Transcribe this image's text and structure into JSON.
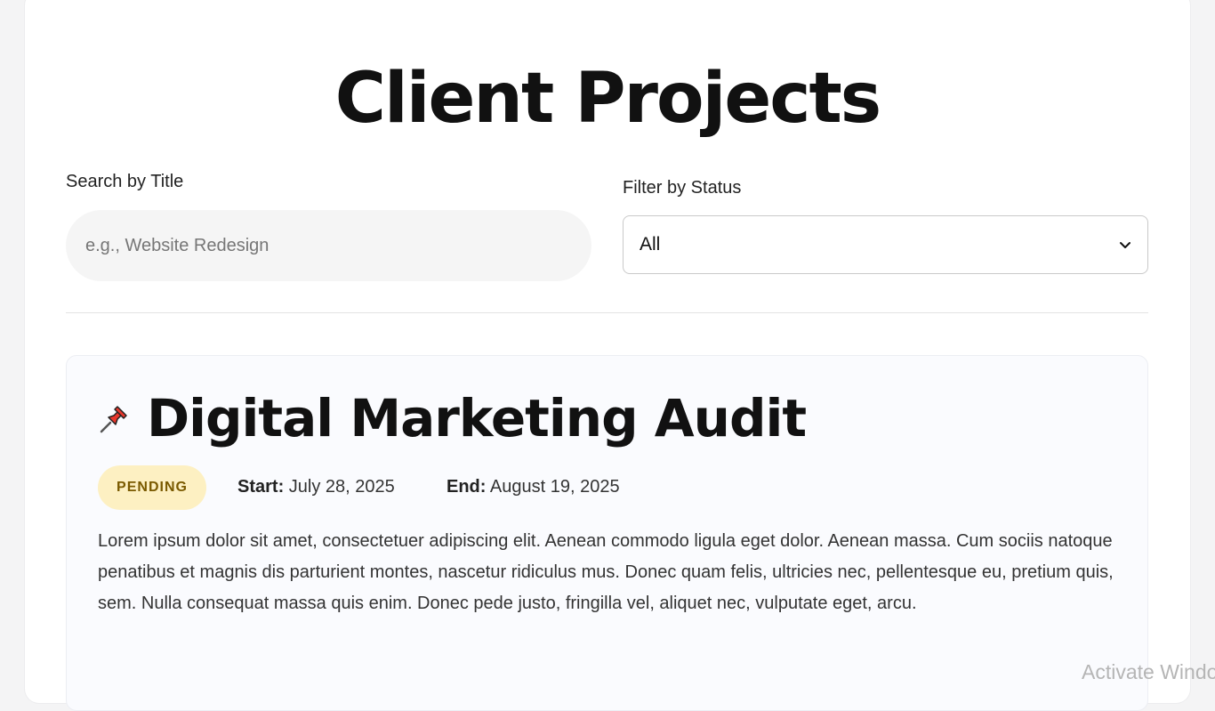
{
  "page": {
    "title": "Client Projects"
  },
  "filters": {
    "search_label": "Search by Title",
    "search_placeholder": "e.g., Website Redesign",
    "search_value": "",
    "status_label": "Filter by Status",
    "status_selected": "All"
  },
  "projects": [
    {
      "icon": "pushpin-icon",
      "title": "Digital Marketing Audit",
      "status": "PENDING",
      "status_color": "#fdf0c2",
      "start_label": "Start:",
      "start_date": "July 28, 2025",
      "end_label": "End:",
      "end_date": "August 19, 2025",
      "description": "Lorem ipsum dolor sit amet, consectetuer adipiscing elit. Aenean commodo ligula eget dolor. Aenean massa. Cum sociis natoque penatibus et magnis dis parturient montes, nascetur ridiculus mus. Donec quam felis, ultricies nec, pellentesque eu, pretium quis, sem. Nulla consequat massa quis enim. Donec pede justo, fringilla vel, aliquet nec, vulputate eget, arcu."
    }
  ],
  "os": {
    "watermark": "Activate Windows"
  }
}
